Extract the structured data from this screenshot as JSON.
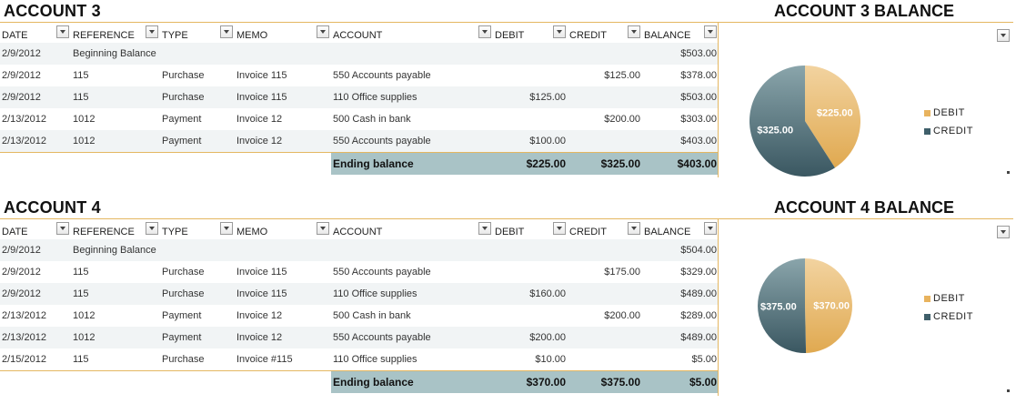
{
  "colors": {
    "debit": "#e8b35e",
    "credit": "#3f5f6a",
    "header_band": "#a9c3c6",
    "accent_border": "#e4b761"
  },
  "columns": [
    "DATE",
    "REFERENCE",
    "TYPE",
    "MEMO",
    "ACCOUNT",
    "DEBIT",
    "CREDIT",
    "BALANCE"
  ],
  "accounts": [
    {
      "title": "ACCOUNT 3",
      "chart_title": "ACCOUNT 3 BALANCE",
      "rows": [
        {
          "date": "2/9/2012",
          "reference": "Beginning Balance",
          "type": "",
          "memo": "",
          "account": "",
          "debit": "",
          "credit": "",
          "balance": "$503.00"
        },
        {
          "date": "2/9/2012",
          "reference": "115",
          "type": "Purchase",
          "memo": "Invoice 115",
          "account": "550 Accounts payable",
          "debit": "",
          "credit": "$125.00",
          "balance": "$378.00"
        },
        {
          "date": "2/9/2012",
          "reference": "115",
          "type": "Purchase",
          "memo": "Invoice 115",
          "account": "110 Office supplies",
          "debit": "$125.00",
          "credit": "",
          "balance": "$503.00"
        },
        {
          "date": "2/13/2012",
          "reference": "1012",
          "type": "Payment",
          "memo": "Invoice 12",
          "account": "500 Cash in bank",
          "debit": "",
          "credit": "$200.00",
          "balance": "$303.00"
        },
        {
          "date": "2/13/2012",
          "reference": "1012",
          "type": "Payment",
          "memo": "Invoice 12",
          "account": "550 Accounts payable",
          "debit": "$100.00",
          "credit": "",
          "balance": "$403.00"
        }
      ],
      "total": {
        "label": "Ending balance",
        "debit": "$225.00",
        "credit": "$325.00",
        "balance": "$403.00"
      },
      "chart_data": {
        "type": "pie",
        "slices": [
          {
            "name": "DEBIT",
            "value": 225,
            "label": "$225.00"
          },
          {
            "name": "CREDIT",
            "value": 325,
            "label": "$325.00"
          }
        ],
        "legend": [
          "DEBIT",
          "CREDIT"
        ]
      }
    },
    {
      "title": "ACCOUNT 4",
      "chart_title": "ACCOUNT 4 BALANCE",
      "rows": [
        {
          "date": "2/9/2012",
          "reference": "Beginning Balance",
          "type": "",
          "memo": "",
          "account": "",
          "debit": "",
          "credit": "",
          "balance": "$504.00"
        },
        {
          "date": "2/9/2012",
          "reference": "115",
          "type": "Purchase",
          "memo": "Invoice 115",
          "account": "550 Accounts payable",
          "debit": "",
          "credit": "$175.00",
          "balance": "$329.00"
        },
        {
          "date": "2/9/2012",
          "reference": "115",
          "type": "Purchase",
          "memo": "Invoice 115",
          "account": "110 Office supplies",
          "debit": "$160.00",
          "credit": "",
          "balance": "$489.00"
        },
        {
          "date": "2/13/2012",
          "reference": "1012",
          "type": "Payment",
          "memo": "Invoice 12",
          "account": "500 Cash in bank",
          "debit": "",
          "credit": "$200.00",
          "balance": "$289.00"
        },
        {
          "date": "2/13/2012",
          "reference": "1012",
          "type": "Payment",
          "memo": "Invoice 12",
          "account": "550 Accounts payable",
          "debit": "$200.00",
          "credit": "",
          "balance": "$489.00"
        },
        {
          "date": "2/15/2012",
          "reference": "115",
          "type": "Purchase",
          "memo": "Invoice #115",
          "account": "110 Office supplies",
          "debit": "$10.00",
          "credit": "",
          "balance": "$5.00"
        }
      ],
      "total": {
        "label": "Ending balance",
        "debit": "$370.00",
        "credit": "$375.00",
        "balance": "$5.00"
      },
      "chart_data": {
        "type": "pie",
        "slices": [
          {
            "name": "DEBIT",
            "value": 370,
            "label": "$370.00"
          },
          {
            "name": "CREDIT",
            "value": 375,
            "label": "$375.00"
          }
        ],
        "legend": [
          "DEBIT",
          "CREDIT"
        ]
      }
    }
  ]
}
